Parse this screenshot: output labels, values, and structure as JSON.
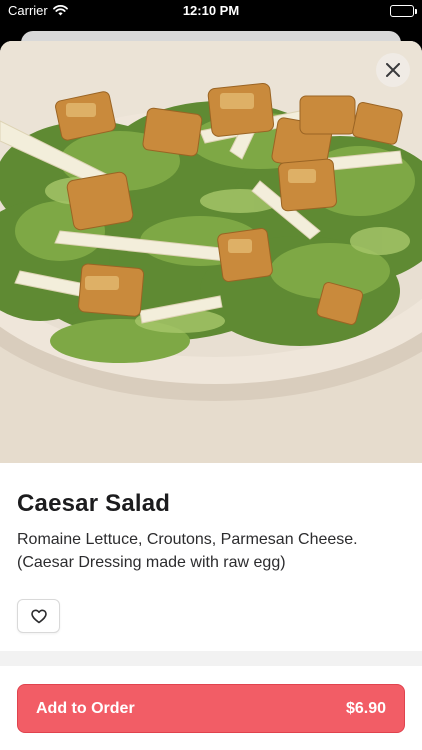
{
  "status_bar": {
    "carrier": "Carrier",
    "time": "12:10 PM"
  },
  "item": {
    "name": "Caesar Salad",
    "description": "Romaine Lettuce, Croutons, Parmesan Cheese. (Caesar Dressing made with raw egg)",
    "image_icon": "caesar-salad-photo"
  },
  "icons": {
    "close": "close-icon",
    "favorite": "heart-icon"
  },
  "order_button": {
    "label": "Add to Order",
    "price": "$6.90"
  },
  "colors": {
    "accent": "#f25d66",
    "accent_border": "#e0434e",
    "title": "#1c1c1e",
    "body": "#2c2c2e"
  }
}
